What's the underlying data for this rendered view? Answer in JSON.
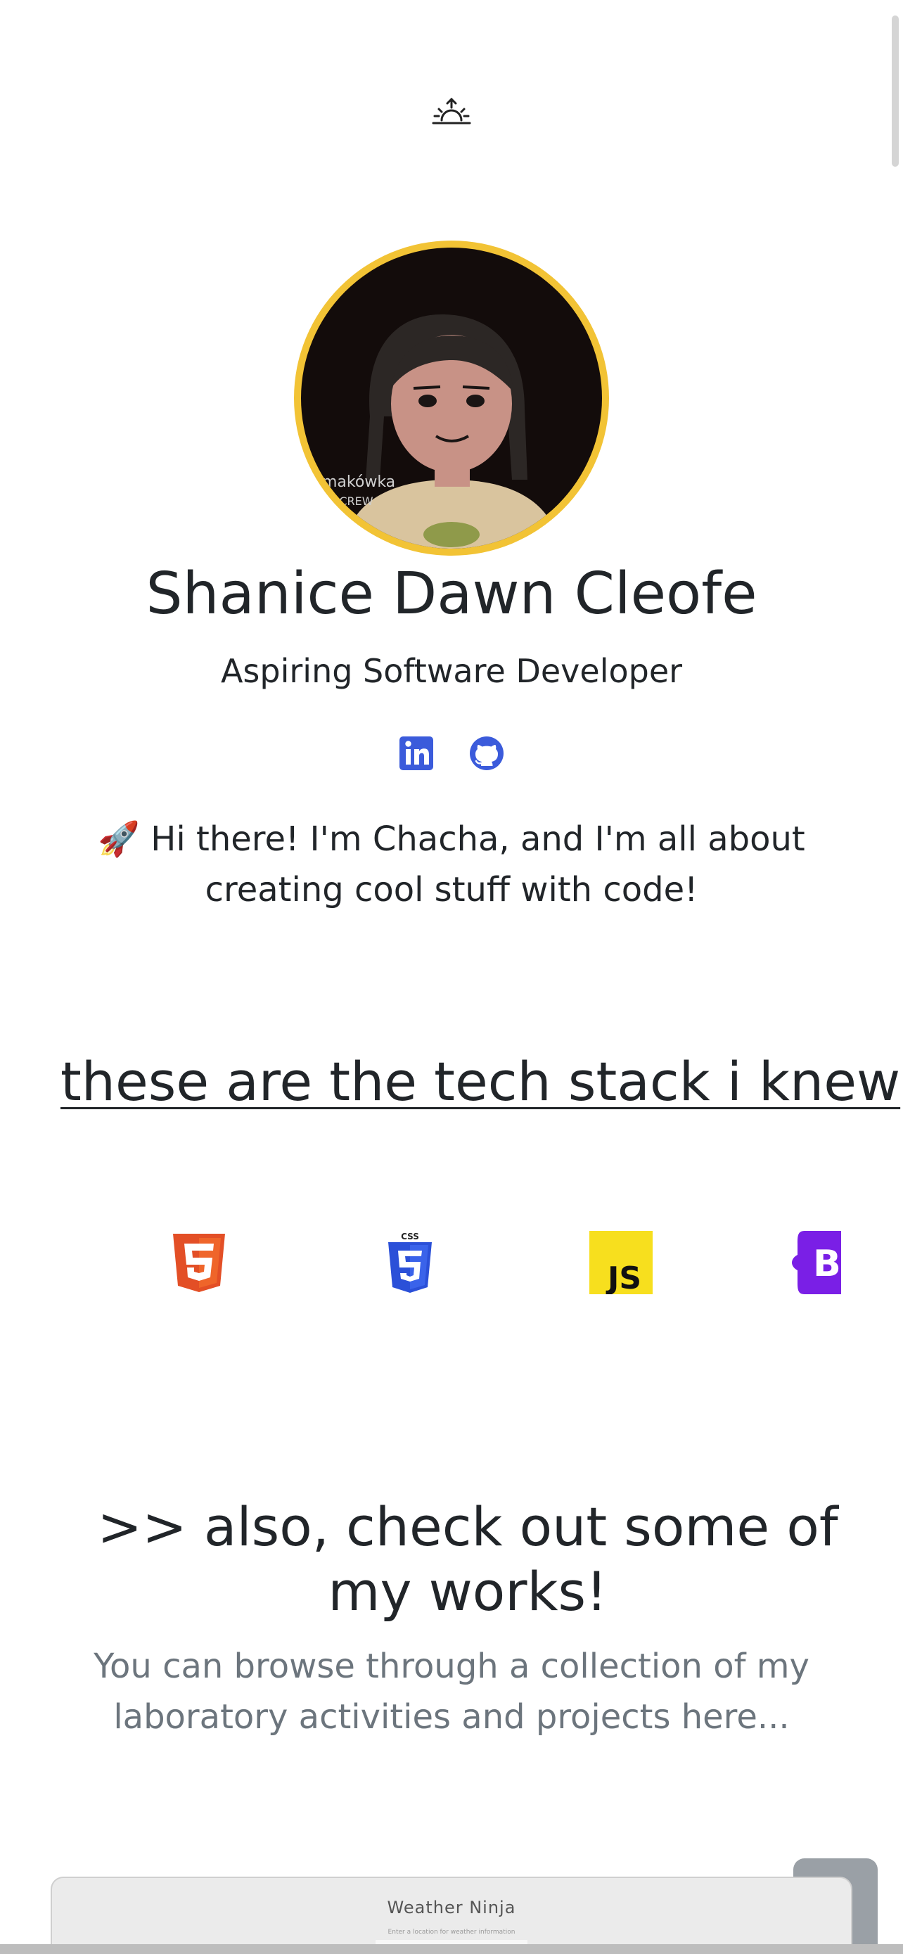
{
  "profile": {
    "name": "Shanice Dawn Cleofe",
    "subtitle": "Aspiring Software Developer",
    "intro": "🚀 Hi there! I'm Chacha, and I'm all about creating cool stuff with code!",
    "avatar_ring_color": "#f2c335"
  },
  "social": [
    {
      "name": "linkedin-icon",
      "color": "#3b5bdb"
    },
    {
      "name": "github-icon",
      "color": "#3b5bdb"
    }
  ],
  "stack": {
    "title": "these are the tech stack i knew",
    "items": [
      "html5-icon",
      "css3-icon",
      "javascript-icon",
      "bootstrap-icon"
    ]
  },
  "works": {
    "title": ">> also, check out some of my works!",
    "description": "You can browse through a collection of my laboratory activities and projects here..."
  },
  "project": {
    "title": "Weather Ninja",
    "hint": "Enter a location for weather information"
  },
  "icons": {
    "theme_toggle": "sunrise-icon",
    "back_to_top": "back-to-top-button"
  }
}
